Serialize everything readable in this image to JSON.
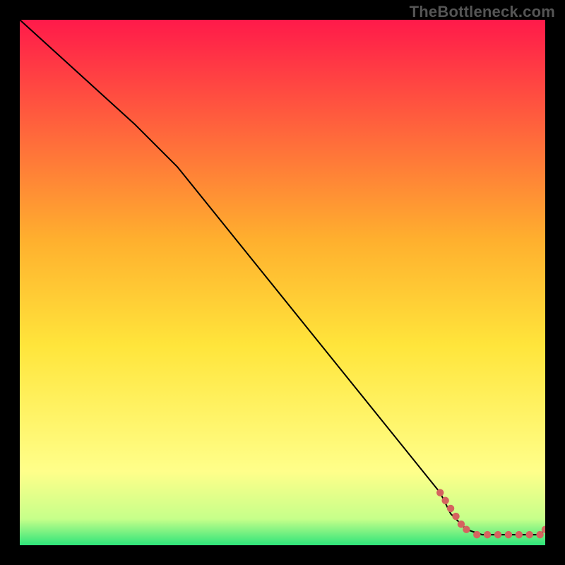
{
  "watermark": "TheBottleneck.com",
  "colors": {
    "background": "#000000",
    "gradient_top": "#ff1a4a",
    "gradient_mid_top": "#ffb02e",
    "gradient_mid": "#ffe53b",
    "gradient_low": "#ffff8a",
    "gradient_near_bottom": "#c6ff8a",
    "gradient_bottom": "#2ee47a",
    "curve": "#000000",
    "points": "#d5635f",
    "watermark_text": "#555555"
  },
  "chart_data": {
    "type": "line",
    "title": "",
    "xlabel": "",
    "ylabel": "",
    "xlim": [
      0,
      100
    ],
    "ylim": [
      0,
      100
    ],
    "grid": false,
    "legend": false,
    "curve_points": [
      {
        "x": 0,
        "y": 100
      },
      {
        "x": 22,
        "y": 80
      },
      {
        "x": 30,
        "y": 72
      },
      {
        "x": 80,
        "y": 10
      },
      {
        "x": 82,
        "y": 6
      },
      {
        "x": 85,
        "y": 3
      },
      {
        "x": 88,
        "y": 2
      },
      {
        "x": 99,
        "y": 2
      },
      {
        "x": 100,
        "y": 3
      }
    ],
    "scatter_points": [
      {
        "x": 80,
        "y": 10.0
      },
      {
        "x": 81,
        "y": 8.5
      },
      {
        "x": 82,
        "y": 7.0
      },
      {
        "x": 83,
        "y": 5.5
      },
      {
        "x": 84,
        "y": 4.0
      },
      {
        "x": 85,
        "y": 3.0
      },
      {
        "x": 87,
        "y": 2.0
      },
      {
        "x": 89,
        "y": 2.0
      },
      {
        "x": 91,
        "y": 2.0
      },
      {
        "x": 93,
        "y": 2.0
      },
      {
        "x": 95,
        "y": 2.0
      },
      {
        "x": 97,
        "y": 2.0
      },
      {
        "x": 99,
        "y": 2.0
      },
      {
        "x": 100,
        "y": 3.0
      }
    ]
  }
}
